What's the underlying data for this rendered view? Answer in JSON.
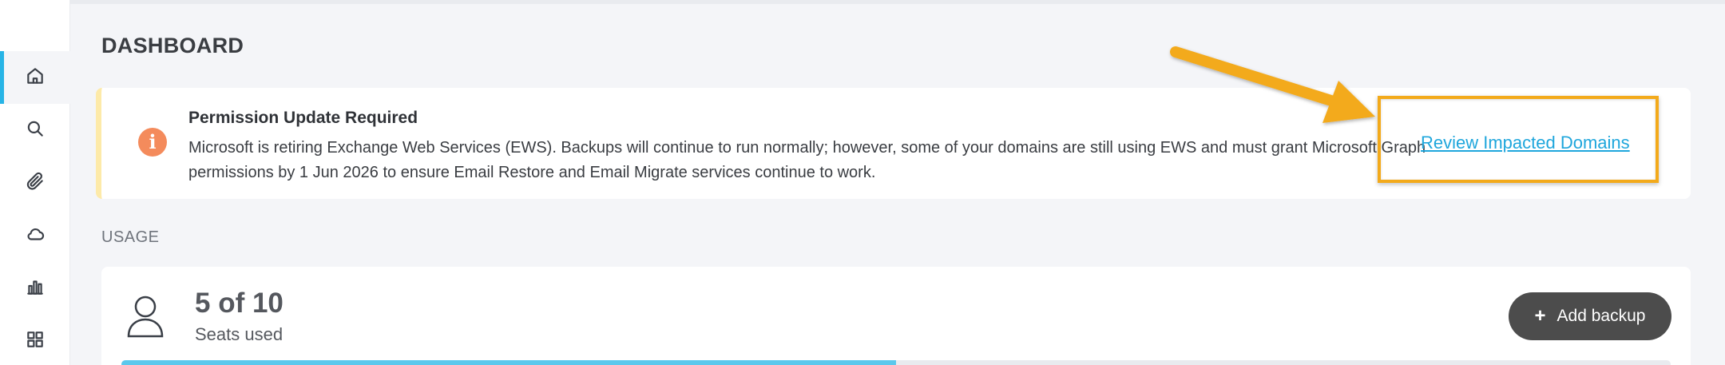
{
  "sidebar": {
    "items": [
      {
        "icon": "home-icon",
        "active": true
      },
      {
        "icon": "search-icon",
        "active": false
      },
      {
        "icon": "paperclip-icon",
        "active": false
      },
      {
        "icon": "cloud-icon",
        "active": false
      },
      {
        "icon": "bar-chart-icon",
        "active": false
      },
      {
        "icon": "grid-icon",
        "active": false
      }
    ]
  },
  "page": {
    "title": "DASHBOARD"
  },
  "alert": {
    "icon": "info-icon",
    "icon_glyph": "i",
    "title": "Permission Update Required",
    "body": "Microsoft is retiring Exchange Web Services (EWS). Backups will continue to run normally; however, some of your domains are still using EWS and must grant Microsoft Graph permissions by 1 Jun 2026 to ensure Email Restore and Email Migrate services continue to work.",
    "link_label": "Review Impacted Domains",
    "icon_color": "#f48b5c",
    "border_color": "#fdeaa9",
    "highlight_color": "#f3aa1b"
  },
  "usage": {
    "section_label": "USAGE",
    "seats_count": "5 of 10",
    "seats_label": "Seats used",
    "add_button_label": "Add backup",
    "progress_fraction": 0.5,
    "progress_color": "#5bc8ec"
  }
}
